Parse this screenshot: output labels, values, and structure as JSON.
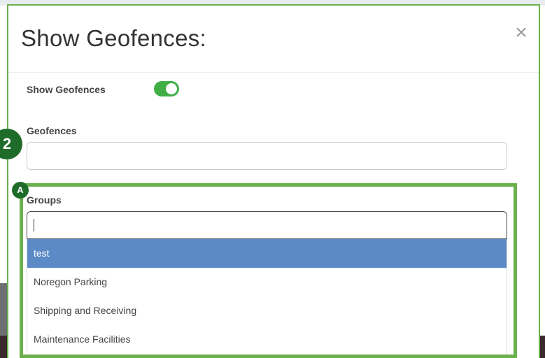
{
  "modal": {
    "title": "Show Geofences:",
    "close_icon": "close-icon",
    "close_glyph": "×"
  },
  "show_geofences": {
    "label": "Show Geofences",
    "enabled": true
  },
  "geofences": {
    "label": "Geofences",
    "value": ""
  },
  "groups": {
    "label": "Groups",
    "value": "",
    "options": [
      {
        "label": "test",
        "selected": true
      },
      {
        "label": "Noregon Parking",
        "selected": false
      },
      {
        "label": "Shipping and Receiving",
        "selected": false
      },
      {
        "label": "Maintenance Facilities",
        "selected": false
      }
    ]
  },
  "annotations": {
    "step_badge": "2",
    "section_badge": "A"
  },
  "colors": {
    "highlight_green": "#6ab04c",
    "badge_green": "#1f6b2a",
    "toggle_on": "#3fae45",
    "selected_option": "#5b8ac6"
  }
}
